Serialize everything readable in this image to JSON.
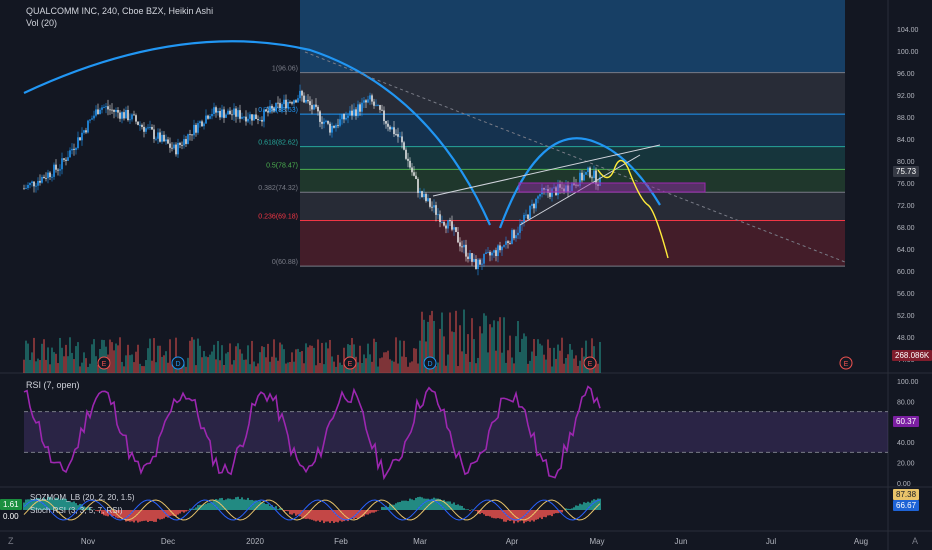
{
  "header": {
    "symbol_line": "QUALCOMM INC, 240, Cboe BZX, Heikin Ashi",
    "vol_label": "Vol (20)"
  },
  "price_axis": {
    "ticks": [
      "104.00",
      "100.00",
      "96.00",
      "92.00",
      "88.00",
      "84.00",
      "80.00",
      "76.00",
      "72.00",
      "68.00",
      "64.00",
      "60.00",
      "56.00",
      "52.00",
      "48.00",
      "44.00"
    ],
    "last_price": "75.73",
    "volume_value": "268.086K"
  },
  "fib_levels": [
    {
      "label": "1(96.06)",
      "price": 96.06,
      "color": "#787b86"
    },
    {
      "label": "0.786(88.53)",
      "price": 88.53,
      "color": "#2196f3"
    },
    {
      "label": "0.618(82.62)",
      "price": 82.62,
      "color": "#26a69a"
    },
    {
      "label": "0.5(78.47)",
      "price": 78.47,
      "color": "#4caf50"
    },
    {
      "label": "0.382(74.32)",
      "price": 74.32,
      "color": "#787b86"
    },
    {
      "label": "0.236(69.18)",
      "price": 69.18,
      "color": "#f23645"
    },
    {
      "label": "0(60.88)",
      "price": 60.88,
      "color": "#787b86"
    }
  ],
  "event_markers": [
    "E",
    "D",
    "E",
    "D",
    "E",
    "E"
  ],
  "rsi": {
    "label": "RSI (7, open)",
    "ticks": [
      "100.00",
      "80.00",
      "60.00",
      "40.00",
      "20.00",
      "0.00"
    ],
    "value": "60.37"
  },
  "momentum": {
    "label1": "SQZMOM_LB (20, 2, 20, 1.5)",
    "label2": "Stoch RSI (3, 3, 5, 7, RSI)",
    "left_value1": "1.61",
    "left_value2": "0.00",
    "value1": "87.38",
    "value2": "66.67"
  },
  "time_axis": [
    "Nov",
    "Dec",
    "2020",
    "Feb",
    "Mar",
    "Apr",
    "May",
    "Jun",
    "Jul",
    "Aug"
  ],
  "corner_labels": {
    "left": "Z",
    "right": "A"
  },
  "colors": {
    "background": "#131722",
    "up": "#26a69a",
    "down": "#ef5350",
    "blue_candle": "#2196f3",
    "arc": "#2196f3",
    "rsi": "#9c27b0",
    "projection": "#ffeb3b",
    "fib_label": "#787b86"
  }
}
